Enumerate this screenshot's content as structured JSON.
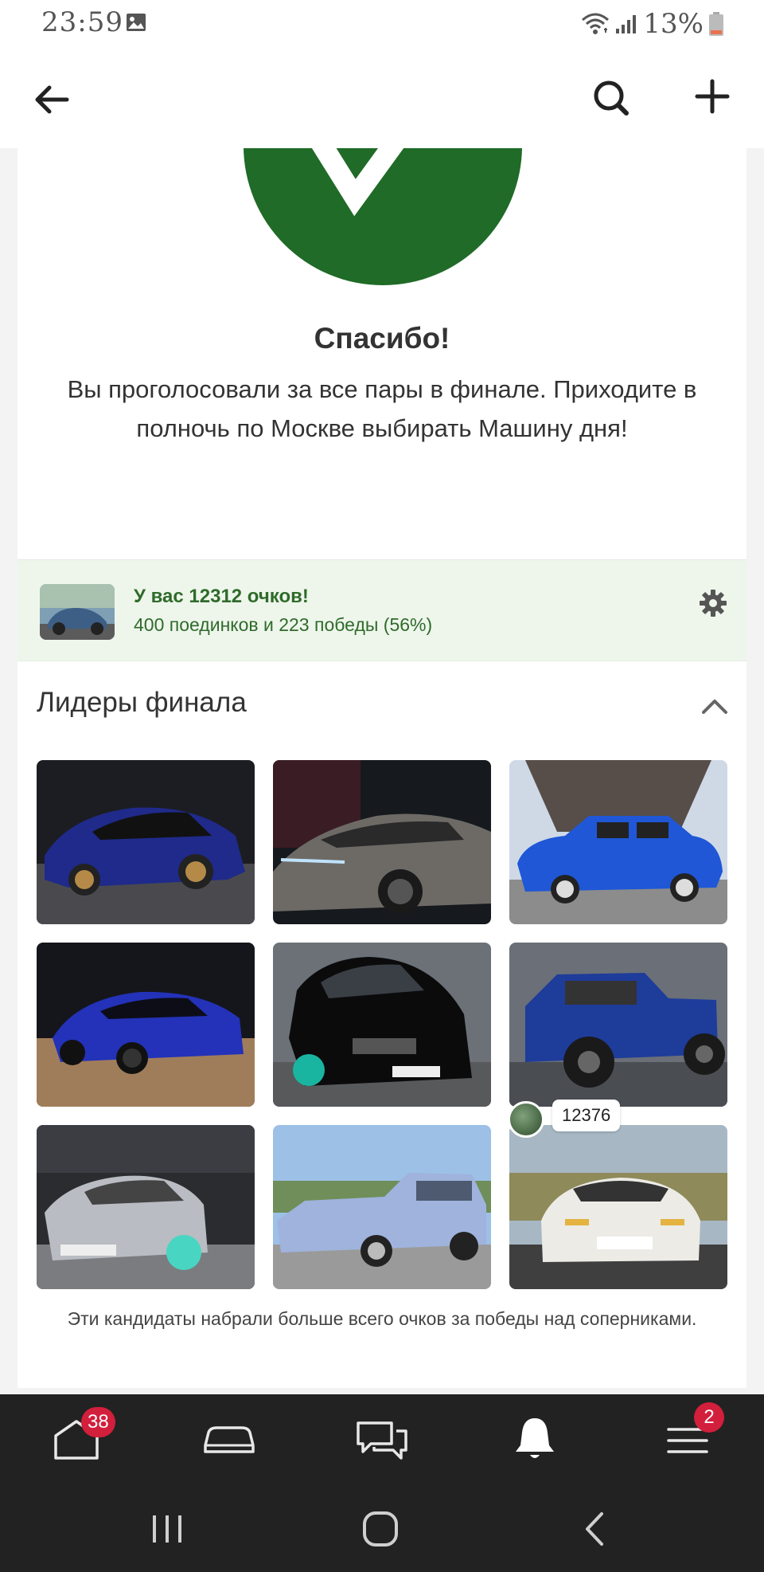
{
  "status_bar": {
    "time": "23:59",
    "battery": "13%",
    "icons": [
      "image-icon",
      "wifi-icon",
      "signal-icon",
      "battery-icon"
    ]
  },
  "app_bar": {
    "icons": [
      "back-arrow-icon",
      "search-icon",
      "plus-icon"
    ]
  },
  "result": {
    "title": "Спасибо!",
    "message": "Вы проголосовали за все пары в финале. Приходите в полночь по Москве выбирать Машину дня!"
  },
  "score": {
    "title": "У вас 12312 очков!",
    "subtitle": "400 поединков и 223 победы (56%)"
  },
  "leaders": {
    "title": "Лидеры финала",
    "note": "Эти кандидаты набрали больше всего очков за победы над соперниками.",
    "badge_value": "12376",
    "tiles": [
      {
        "name": "blue-audi-sedan"
      },
      {
        "name": "grey-audi-a6"
      },
      {
        "name": "blue-volga-eiffel"
      },
      {
        "name": "blue-skoda-octavia-rs"
      },
      {
        "name": "black-toyota-chaser"
      },
      {
        "name": "blue-niva-pickup"
      },
      {
        "name": "silver-skoda-octavia"
      },
      {
        "name": "light-blue-chevrolet-wagon"
      },
      {
        "name": "white-porsche-924"
      }
    ]
  },
  "bottom_nav": {
    "home_badge": "38",
    "menu_badge": "2",
    "items": [
      "home-icon",
      "car-icon",
      "chat-icon",
      "bell-icon",
      "menu-icon"
    ]
  },
  "colors": {
    "accent_green": "#1f6b27",
    "score_bg": "#eef6ec",
    "score_text": "#2f6b2a",
    "badge_red": "#d21f3c",
    "nav_bg": "#222222"
  }
}
